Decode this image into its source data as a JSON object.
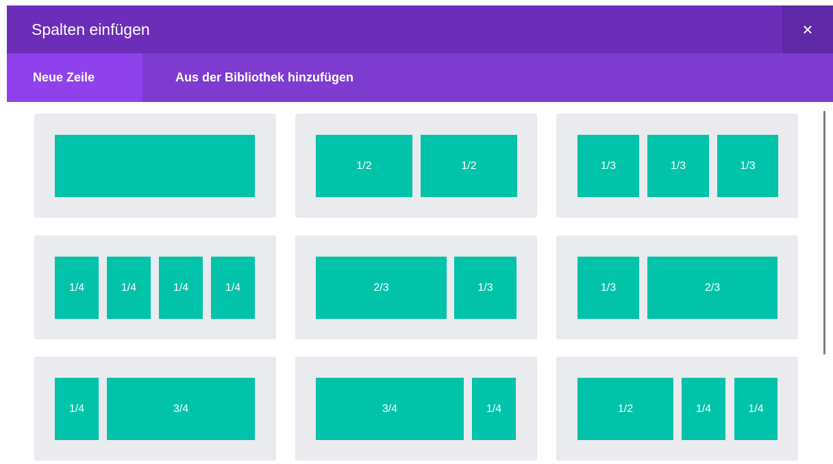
{
  "dialog": {
    "title": "Spalten einfügen",
    "close_glyph": "×"
  },
  "tabs": [
    {
      "label": "Neue Zeile",
      "active": true
    },
    {
      "label": "Aus der Bibliothek hinzufügen",
      "active": false
    }
  ],
  "colors": {
    "header": "#6c2eb9",
    "tabbar": "#7e3bd0",
    "active_tab": "#8f42ec",
    "column": "#00c3aa",
    "card": "#e9ebee"
  },
  "layouts": [
    {
      "columns": [
        ""
      ]
    },
    {
      "columns": [
        "1/2",
        "1/2"
      ]
    },
    {
      "columns": [
        "1/3",
        "1/3",
        "1/3"
      ]
    },
    {
      "columns": [
        "1/4",
        "1/4",
        "1/4",
        "1/4"
      ]
    },
    {
      "columns": [
        "2/3",
        "1/3"
      ]
    },
    {
      "columns": [
        "1/3",
        "2/3"
      ]
    },
    {
      "columns": [
        "1/4",
        "3/4"
      ]
    },
    {
      "columns": [
        "3/4",
        "1/4"
      ]
    },
    {
      "columns": [
        "1/2",
        "1/4",
        "1/4"
      ]
    }
  ]
}
